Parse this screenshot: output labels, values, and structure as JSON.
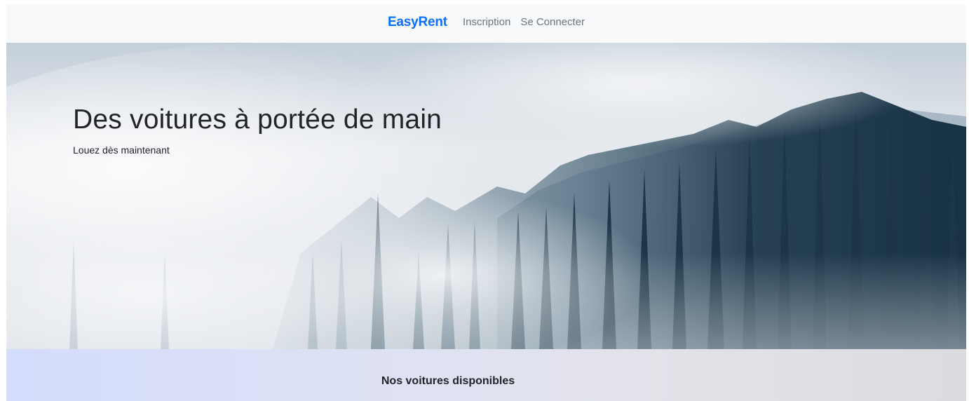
{
  "navbar": {
    "brand": "EasyRent",
    "links": [
      "Inscription",
      "Se Connecter"
    ]
  },
  "hero": {
    "title": "Des voitures à portée de main",
    "subtitle": "Louez dès maintenant",
    "image": "misty-pine-forest"
  },
  "section": {
    "title": "Nos voitures disponibles"
  },
  "colors": {
    "brand": "#0d6efd",
    "nav_link": "#6c757d",
    "navbar_bg": "#f8f9fa",
    "text": "#212529"
  }
}
